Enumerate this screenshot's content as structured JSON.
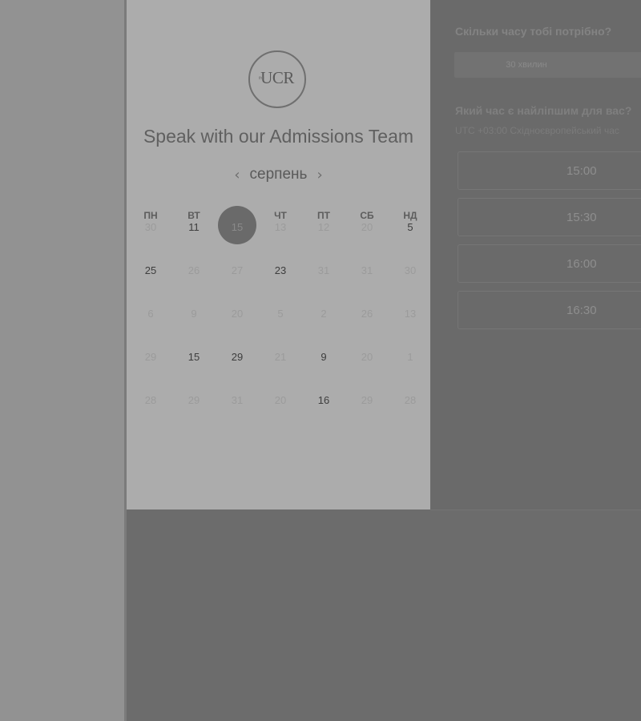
{
  "calendar_panel": {
    "logo_text": "UCR",
    "logo_small": "the",
    "title": "Speak with our Admissions Team",
    "month": "серпень",
    "prev_icon": "chevron-left-icon",
    "next_icon": "chevron-right-icon",
    "weekdays": [
      "ПН",
      "ВТ",
      "СР",
      "ЧТ",
      "ПТ",
      "СБ",
      "НД"
    ],
    "weeks": [
      [
        {
          "d": "30",
          "a": false
        },
        {
          "d": "11",
          "a": true
        },
        {
          "d": "15",
          "a": true,
          "sel": true
        },
        {
          "d": "13",
          "a": false
        },
        {
          "d": "12",
          "a": false
        },
        {
          "d": "20",
          "a": false
        },
        {
          "d": "5",
          "a": true
        }
      ],
      [
        {
          "d": "25",
          "a": true
        },
        {
          "d": "26",
          "a": false
        },
        {
          "d": "27",
          "a": false
        },
        {
          "d": "23",
          "a": true
        },
        {
          "d": "31",
          "a": false
        },
        {
          "d": "31",
          "a": false
        },
        {
          "d": "30",
          "a": false
        }
      ],
      [
        {
          "d": "6",
          "a": false
        },
        {
          "d": "9",
          "a": false
        },
        {
          "d": "20",
          "a": false
        },
        {
          "d": "5",
          "a": false
        },
        {
          "d": "2",
          "a": false
        },
        {
          "d": "26",
          "a": false
        },
        {
          "d": "13",
          "a": false
        }
      ],
      [
        {
          "d": "29",
          "a": false
        },
        {
          "d": "15",
          "a": true
        },
        {
          "d": "29",
          "a": true
        },
        {
          "d": "21",
          "a": false
        },
        {
          "d": "9",
          "a": true
        },
        {
          "d": "20",
          "a": false
        },
        {
          "d": "1",
          "a": false
        }
      ],
      [
        {
          "d": "28",
          "a": false
        },
        {
          "d": "29",
          "a": false
        },
        {
          "d": "31",
          "a": false
        },
        {
          "d": "20",
          "a": false
        },
        {
          "d": "16",
          "a": true
        },
        {
          "d": "29",
          "a": false
        },
        {
          "d": "28",
          "a": false
        }
      ]
    ]
  },
  "booking_panel": {
    "duration_question": "Скільки часу тобі потрібно?",
    "duration_value": "30 хвилин",
    "time_question": "Який час є найліпшим для вас?",
    "timezone": "UTC +03:00 Східноєвропейський час",
    "slots": [
      "15:00",
      "15:30",
      "16:00",
      "16:30"
    ]
  }
}
